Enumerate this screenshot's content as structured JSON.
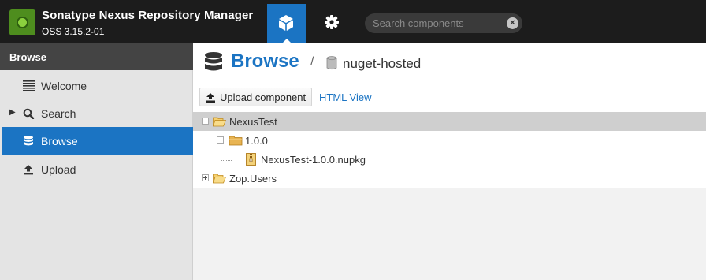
{
  "header": {
    "app_title": "Sonatype Nexus Repository Manager",
    "version": "OSS 3.15.2-01",
    "search_placeholder": "Search components",
    "search_clear": "×",
    "accent_color": "#1b74c3"
  },
  "sidebar": {
    "header": "Browse",
    "items": [
      {
        "label": "Welcome",
        "icon": "list-icon"
      },
      {
        "label": "Search",
        "icon": "search-icon"
      },
      {
        "label": "Browse",
        "icon": "database-icon"
      },
      {
        "label": "Upload",
        "icon": "upload-icon"
      }
    ]
  },
  "main": {
    "title": "Browse",
    "breadcrumb_sep": "/",
    "repository": "nuget-hosted",
    "upload_button": "Upload component",
    "html_view_link": "HTML View",
    "tree": [
      {
        "label": "NexusTest",
        "level": 0
      },
      {
        "label": "1.0.0",
        "level": 1
      },
      {
        "label": "NexusTest-1.0.0.nupkg",
        "level": 2
      },
      {
        "label": "Zop.Users",
        "level": 0
      }
    ]
  }
}
